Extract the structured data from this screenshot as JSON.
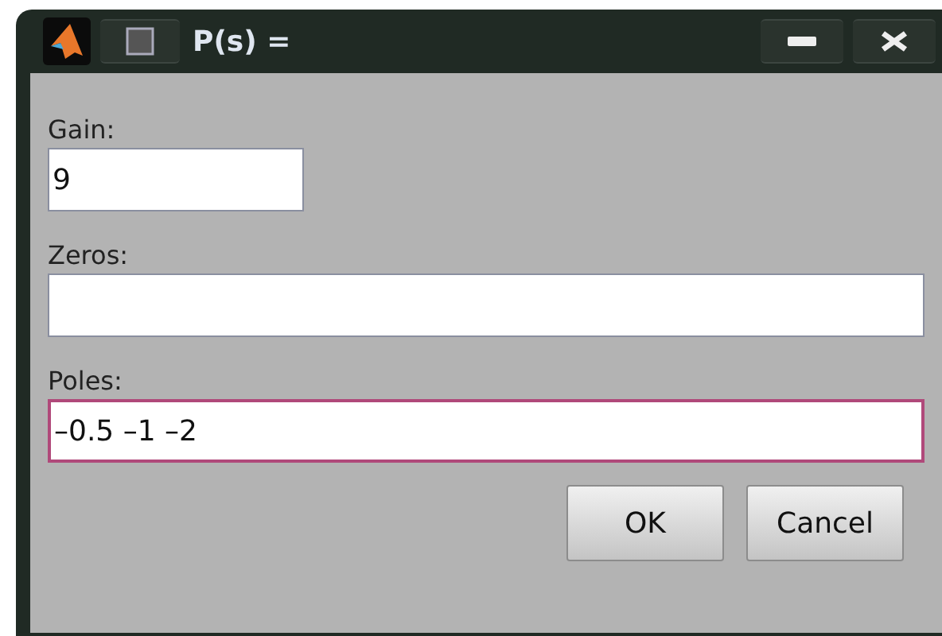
{
  "window": {
    "title": "P(s) ="
  },
  "fields": [
    {
      "label": "Gain:",
      "value": "9",
      "kind": "short",
      "focused": false
    },
    {
      "label": "Zeros:",
      "kind": "wide",
      "focused": false
    },
    {
      "label": "Poles:",
      "value": "–0.5 –1 –2",
      "kind": "wide",
      "focused": true
    }
  ],
  "buttons": [
    "OK",
    "Cancel"
  ]
}
